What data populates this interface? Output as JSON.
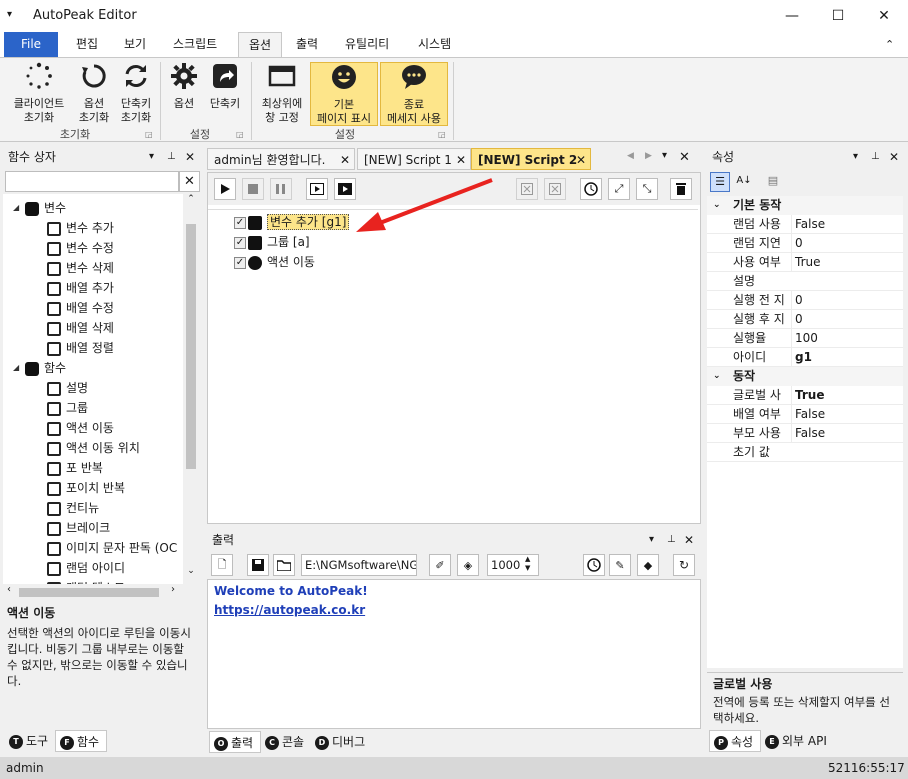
{
  "window": {
    "title": "AutoPeak Editor",
    "min": "—",
    "max": "☐",
    "close": "✕"
  },
  "menu": {
    "file": "File",
    "tabs": [
      "편집",
      "보기",
      "스크립트",
      "옵션",
      "출력",
      "유틸리티",
      "시스템"
    ],
    "active": "옵션",
    "collapse": "⌃"
  },
  "ribbon": {
    "groups": [
      {
        "label": "초기화",
        "buttons": [
          {
            "l1": "클라이언트",
            "l2": "초기화",
            "icon": "spinner-icon"
          },
          {
            "l1": "옵션",
            "l2": "초기화",
            "icon": "refresh-icon"
          },
          {
            "l1": "단축키",
            "l2": "초기화",
            "icon": "sync-icon"
          }
        ]
      },
      {
        "label": "설정",
        "buttons": [
          {
            "l1": "옵션",
            "l2": "",
            "icon": "gear-icon"
          },
          {
            "l1": "단축키",
            "l2": "",
            "icon": "shortcut-icon"
          }
        ]
      },
      {
        "label": "설정",
        "buttons": [
          {
            "l1": "최상위에",
            "l2": "창 고정",
            "icon": "window-icon"
          },
          {
            "l1": "기본",
            "l2": "페이지 표시",
            "icon": "smile-icon"
          },
          {
            "l1": "종료",
            "l2": "메세지 사용",
            "icon": "chat-icon"
          }
        ]
      }
    ]
  },
  "left_panel": {
    "title": "함수 상자",
    "search_value": "",
    "tree": [
      {
        "label": "변수",
        "level": 0,
        "icon": "variable-group-icon",
        "expander": "◢"
      },
      {
        "label": "변수 추가",
        "level": 1,
        "icon": "cube-add-icon"
      },
      {
        "label": "변수 수정",
        "level": 1,
        "icon": "cube-edit-icon"
      },
      {
        "label": "변수 삭제",
        "level": 1,
        "icon": "cube-delete-icon"
      },
      {
        "label": "배열 추가",
        "level": 1,
        "icon": "array-add-icon"
      },
      {
        "label": "배열 수정",
        "level": 1,
        "icon": "array-edit-icon"
      },
      {
        "label": "배열 삭제",
        "level": 1,
        "icon": "array-delete-icon"
      },
      {
        "label": "배열 정렬",
        "level": 1,
        "icon": "sort-icon"
      },
      {
        "label": "함수",
        "level": 0,
        "icon": "function-icon",
        "expander": "◢"
      },
      {
        "label": "설명",
        "level": 1,
        "icon": "comment-icon"
      },
      {
        "label": "그룹",
        "level": 1,
        "icon": "group-icon"
      },
      {
        "label": "액션 이동",
        "level": 1,
        "icon": "action-move-icon"
      },
      {
        "label": "액션 이동 위치",
        "level": 1,
        "icon": "action-position-icon"
      },
      {
        "label": "포 반복",
        "level": 1,
        "icon": "for-loop-icon"
      },
      {
        "label": "포이치 반복",
        "level": 1,
        "icon": "foreach-loop-icon"
      },
      {
        "label": "컨티뉴",
        "level": 1,
        "icon": "continue-icon"
      },
      {
        "label": "브레이크",
        "level": 1,
        "icon": "break-icon"
      },
      {
        "label": "이미지 문자 판독 (OC",
        "level": 1,
        "icon": "ocr-icon"
      },
      {
        "label": "랜덤 아이디",
        "level": 1,
        "icon": "random-icon"
      },
      {
        "label": "랜덤 텍스트",
        "level": 1,
        "icon": "random-text-icon"
      }
    ],
    "desc_title": "액션 이동",
    "desc_text": "선택한 액션의 아이디로 루틴을 이동시킵니다. 비동기 그룹 내부로는 이동할 수 없지만, 밖으로는 이동할 수 있습니다.",
    "bottom_tabs": [
      {
        "letter": "T",
        "label": "도구"
      },
      {
        "letter": "F",
        "label": "함수"
      }
    ]
  },
  "editor": {
    "tabs": [
      {
        "label": "admin님 환영합니다."
      },
      {
        "label": "[NEW] Script 1"
      },
      {
        "label": "[NEW] Script 2"
      }
    ],
    "active_tab": 2,
    "tree": [
      {
        "label": "변수 추가 [g1]",
        "checked": true,
        "icon": "cube-icon",
        "selected": true
      },
      {
        "label": "그룹 [a]",
        "checked": true,
        "icon": "group-icon"
      },
      {
        "label": "액션 이동",
        "checked": true,
        "icon": "action-move-icon"
      }
    ]
  },
  "output": {
    "title": "출력",
    "path_value": "E:\\NGMsoftware\\NG",
    "number_value": "1000",
    "line1": "Welcome to AutoPeak!",
    "line2": "https://autopeak.co.kr",
    "bottom_tabs": [
      {
        "letter": "O",
        "label": "출력"
      },
      {
        "letter": "C",
        "label": "콘솔"
      },
      {
        "letter": "D",
        "label": "디버그"
      }
    ]
  },
  "properties": {
    "title": "속성",
    "cats": [
      {
        "name": "기본 동작",
        "rows": [
          {
            "k": "랜덤 사용",
            "v": "False"
          },
          {
            "k": "랜덤 지연",
            "v": "0"
          },
          {
            "k": "사용 여부",
            "v": "True"
          },
          {
            "k": "설명",
            "v": ""
          },
          {
            "k": "실행 전 지",
            "v": "0"
          },
          {
            "k": "실행 후 지",
            "v": "0"
          },
          {
            "k": "실행율",
            "v": "100"
          },
          {
            "k": "아이디",
            "v": "g1",
            "bold": true
          }
        ]
      },
      {
        "name": "동작",
        "rows": [
          {
            "k": "글로벌 사",
            "v": "True",
            "bold": true
          },
          {
            "k": "배열 여부",
            "v": "False"
          },
          {
            "k": "부모 사용",
            "v": "False"
          },
          {
            "k": "초기 값",
            "v": ""
          }
        ]
      }
    ],
    "desc_title": "글로벌 사용",
    "desc_text": "전역에 등록 또는 삭제할지 여부를 선택하세요.",
    "bottom_tabs": [
      {
        "letter": "P",
        "label": "속성"
      },
      {
        "letter": "E",
        "label": "외부 API"
      }
    ]
  },
  "status": {
    "user": "admin",
    "time": "52116:55:17"
  },
  "colors": {
    "accent": "#2b64c9",
    "highlight": "#fde58a",
    "arrow": "#e8231f"
  }
}
